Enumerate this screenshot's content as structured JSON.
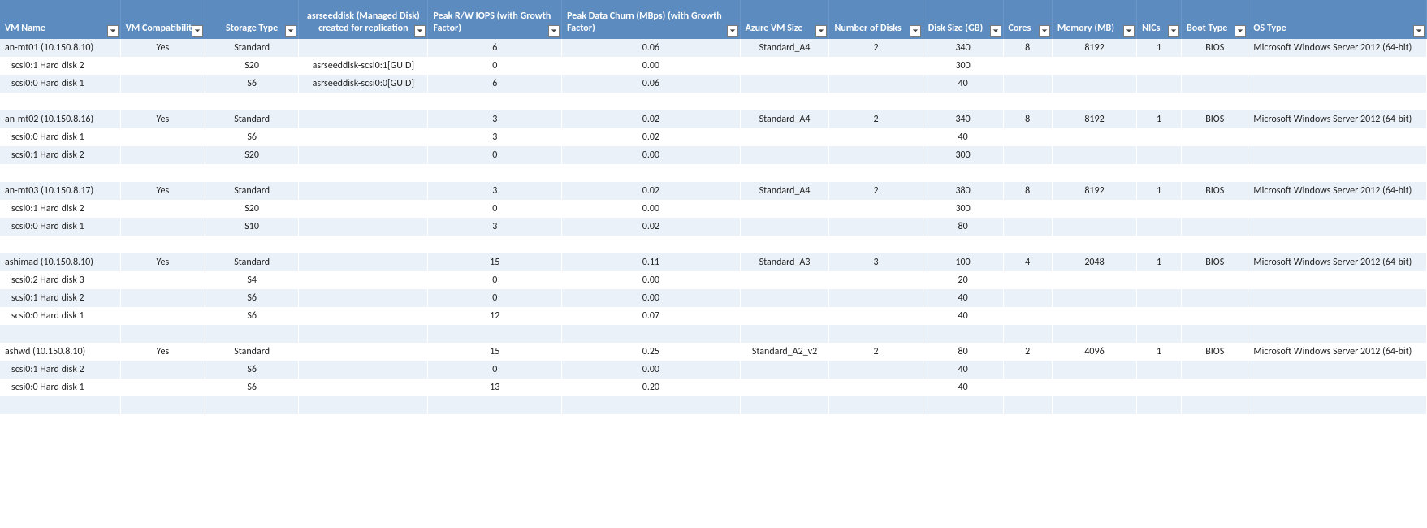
{
  "headers": [
    "VM Name",
    "VM Compatibility",
    "Storage Type",
    "asrseeddisk (Managed Disk) created for replication",
    "Peak R/W IOPS (with Growth Factor)",
    "Peak Data Churn (MBps) (with Growth Factor)",
    "Azure VM Size",
    "Number of Disks",
    "Disk Size (GB)",
    "Cores",
    "Memory (MB)",
    "NICs",
    "Boot Type",
    "OS Type"
  ],
  "rows": [
    {
      "band": "odd",
      "cells": [
        "an-mt01 (10.150.8.10)",
        "Yes",
        "Standard",
        "",
        "6",
        "0.06",
        "Standard_A4",
        "2",
        "340",
        "8",
        "8192",
        "1",
        "BIOS",
        "Microsoft Windows Server 2012 (64-bit)"
      ]
    },
    {
      "band": "even",
      "indent": true,
      "cells": [
        "scsi0:1 Hard disk 2",
        "",
        "S20",
        "asrseeddisk-scsi0:1[GUID]",
        "0",
        "0.00",
        "",
        "",
        "300",
        "",
        "",
        "",
        "",
        ""
      ]
    },
    {
      "band": "odd",
      "indent": true,
      "cells": [
        "scsi0:0 Hard disk 1",
        "",
        "S6",
        "asrseeddisk-scsi0:0[GUID]",
        "6",
        "0.06",
        "",
        "",
        "40",
        "",
        "",
        "",
        "",
        ""
      ]
    },
    {
      "band": "even",
      "blank": true
    },
    {
      "band": "odd",
      "cells": [
        "an-mt02 (10.150.8.16)",
        "Yes",
        "Standard",
        "",
        "3",
        "0.02",
        "Standard_A4",
        "2",
        "340",
        "8",
        "8192",
        "1",
        "BIOS",
        "Microsoft Windows Server 2012 (64-bit)"
      ]
    },
    {
      "band": "even",
      "indent": true,
      "cells": [
        "scsi0:0 Hard disk 1",
        "",
        "S6",
        "",
        "3",
        "0.02",
        "",
        "",
        "40",
        "",
        "",
        "",
        "",
        ""
      ]
    },
    {
      "band": "odd",
      "indent": true,
      "cells": [
        "scsi0:1 Hard disk 2",
        "",
        "S20",
        "",
        "0",
        "0.00",
        "",
        "",
        "300",
        "",
        "",
        "",
        "",
        ""
      ]
    },
    {
      "band": "even",
      "blank": true
    },
    {
      "band": "odd",
      "cells": [
        "an-mt03 (10.150.8.17)",
        "Yes",
        "Standard",
        "",
        "3",
        "0.02",
        "Standard_A4",
        "2",
        "380",
        "8",
        "8192",
        "1",
        "BIOS",
        "Microsoft Windows Server 2012 (64-bit)"
      ]
    },
    {
      "band": "even",
      "indent": true,
      "cells": [
        "scsi0:1 Hard disk 2",
        "",
        "S20",
        "",
        "0",
        "0.00",
        "",
        "",
        "300",
        "",
        "",
        "",
        "",
        ""
      ]
    },
    {
      "band": "odd",
      "indent": true,
      "cells": [
        "scsi0:0 Hard disk 1",
        "",
        "S10",
        "",
        "3",
        "0.02",
        "",
        "",
        "80",
        "",
        "",
        "",
        "",
        ""
      ]
    },
    {
      "band": "even",
      "blank": true
    },
    {
      "band": "odd",
      "cells": [
        "ashimad (10.150.8.10)",
        "Yes",
        "Standard",
        "",
        "15",
        "0.11",
        "Standard_A3",
        "3",
        "100",
        "4",
        "2048",
        "1",
        "BIOS",
        "Microsoft Windows Server 2012 (64-bit)"
      ]
    },
    {
      "band": "even",
      "indent": true,
      "cells": [
        "scsi0:2 Hard disk 3",
        "",
        "S4",
        "",
        "0",
        "0.00",
        "",
        "",
        "20",
        "",
        "",
        "",
        "",
        ""
      ]
    },
    {
      "band": "odd",
      "indent": true,
      "cells": [
        "scsi0:1 Hard disk 2",
        "",
        "S6",
        "",
        "0",
        "0.00",
        "",
        "",
        "40",
        "",
        "",
        "",
        "",
        ""
      ]
    },
    {
      "band": "even",
      "indent": true,
      "cells": [
        "scsi0:0 Hard disk 1",
        "",
        "S6",
        "",
        "12",
        "0.07",
        "",
        "",
        "40",
        "",
        "",
        "",
        "",
        ""
      ]
    },
    {
      "band": "odd",
      "blank": true
    },
    {
      "band": "even",
      "cells": [
        "ashwd (10.150.8.10)",
        "Yes",
        "Standard",
        "",
        "15",
        "0.25",
        "Standard_A2_v2",
        "2",
        "80",
        "2",
        "4096",
        "1",
        "BIOS",
        "Microsoft Windows Server 2012 (64-bit)"
      ]
    },
    {
      "band": "odd",
      "indent": true,
      "cells": [
        "scsi0:1 Hard disk 2",
        "",
        "S6",
        "",
        "0",
        "0.00",
        "",
        "",
        "40",
        "",
        "",
        "",
        "",
        ""
      ]
    },
    {
      "band": "even",
      "indent": true,
      "cells": [
        "scsi0:0 Hard disk 1",
        "",
        "S6",
        "",
        "13",
        "0.20",
        "",
        "",
        "40",
        "",
        "",
        "",
        "",
        ""
      ]
    },
    {
      "band": "odd",
      "blank": true
    },
    {
      "band": "even",
      "blank": true
    }
  ],
  "align": [
    "l",
    "c",
    "c",
    "c",
    "c",
    "c",
    "c",
    "c",
    "c",
    "c",
    "c",
    "c",
    "c",
    "l"
  ],
  "header_center": [
    false,
    false,
    true,
    true,
    false,
    false,
    false,
    false,
    false,
    false,
    false,
    false,
    false,
    false
  ]
}
